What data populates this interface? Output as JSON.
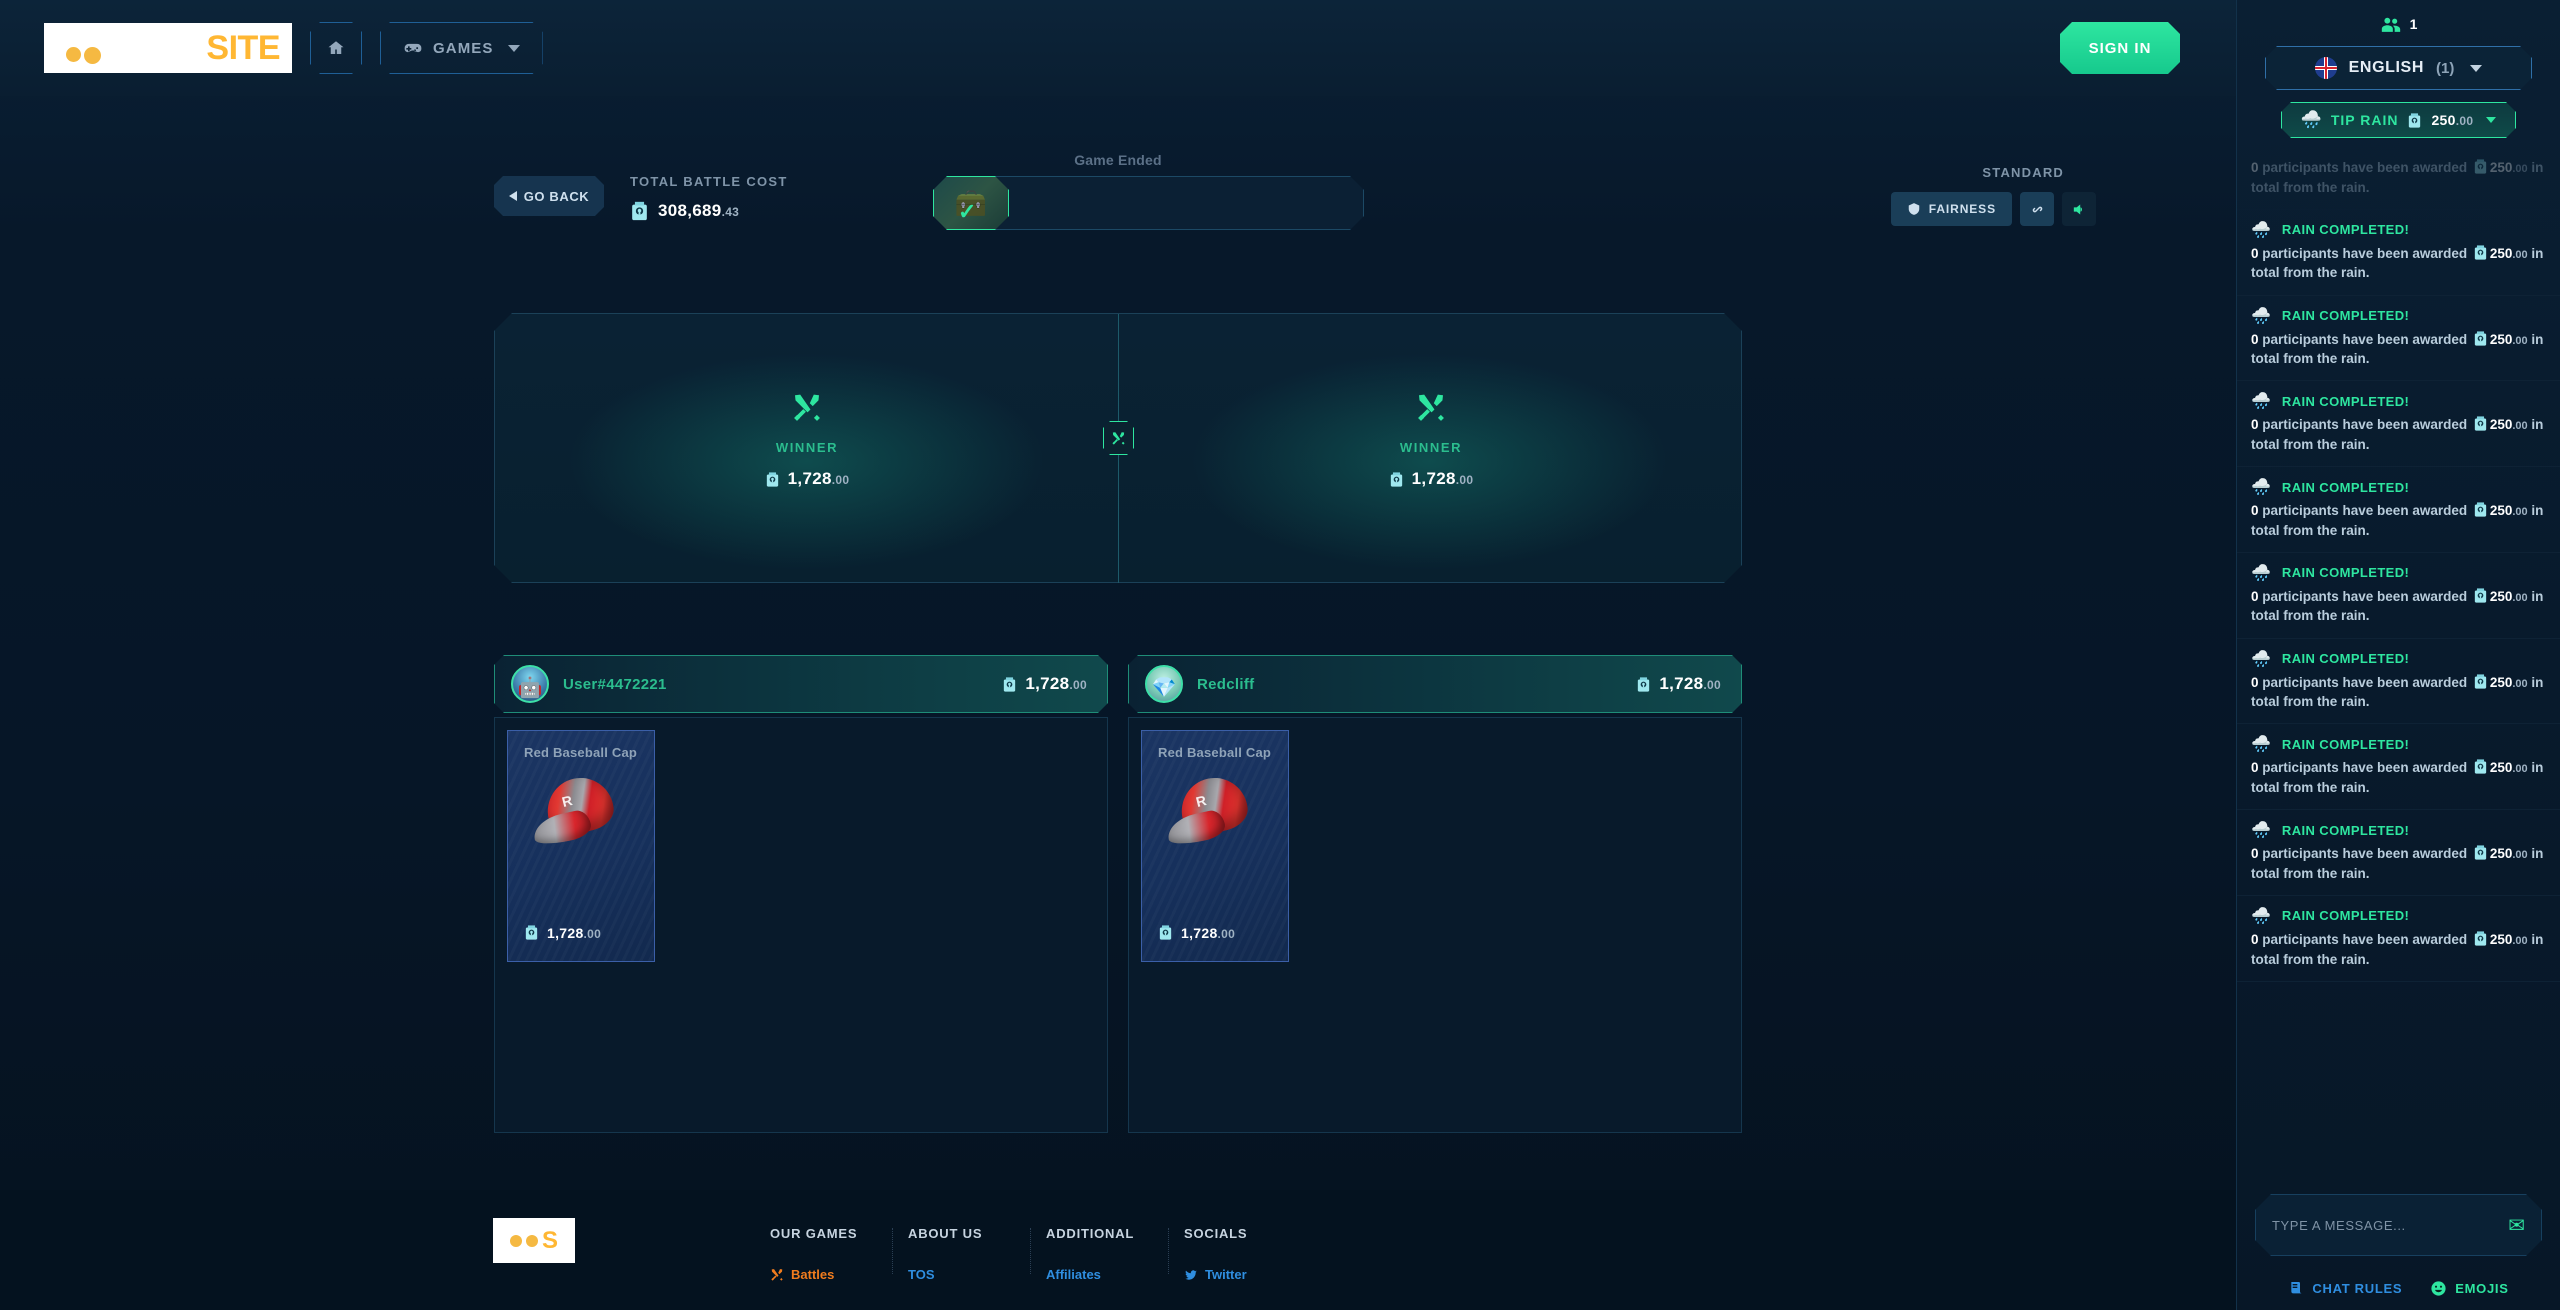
{
  "nav": {
    "logo_text": "SITE",
    "home_label": "Home",
    "games_label": "GAMES",
    "signin_label": "SIGN IN"
  },
  "battle": {
    "go_back": "GO BACK",
    "total_cost_label": "TOTAL BATTLE COST",
    "total_cost_value": "308,689",
    "total_cost_decimals": ".43",
    "status": "Game Ended",
    "mode": "STANDARD",
    "fairness_label": "FAIRNESS",
    "link_icon": "link-icon",
    "sound_icon": "sound-on-icon",
    "sides": [
      {
        "label": "WINNER",
        "value": "1,728",
        "decimals": ".00"
      },
      {
        "label": "WINNER",
        "value": "1,728",
        "decimals": ".00"
      }
    ]
  },
  "players": [
    {
      "name": "User#4472221",
      "total": "1,728",
      "total_decimals": ".00",
      "avatar_icon": "robot-avatar",
      "items": [
        {
          "name": "Red Baseball Cap",
          "price": "1,728",
          "price_decimals": ".00"
        }
      ]
    },
    {
      "name": "Redcliff",
      "total": "1,728",
      "total_decimals": ".00",
      "avatar_icon": "gem-avatar",
      "items": [
        {
          "name": "Red Baseball Cap",
          "price": "1,728",
          "price_decimals": ".00"
        }
      ]
    }
  ],
  "footer": {
    "logo_letter": "S",
    "tagline": "",
    "columns": [
      {
        "title": "OUR GAMES",
        "links": [
          {
            "label": "Battles",
            "style": "orange",
            "icon": "swords-icon"
          }
        ]
      },
      {
        "title": "ABOUT US",
        "links": [
          {
            "label": "TOS",
            "style": "blue",
            "icon": ""
          }
        ]
      },
      {
        "title": "ADDITIONAL",
        "links": [
          {
            "label": "Affiliates",
            "style": "blue",
            "icon": ""
          }
        ]
      },
      {
        "title": "SOCIALS",
        "links": [
          {
            "label": "Twitter",
            "style": "blue",
            "icon": "twitter-icon"
          }
        ]
      }
    ]
  },
  "chat": {
    "online_count": "1",
    "language": "ENGLISH",
    "language_count": "(1)",
    "tip_rain_label": "TIP RAIN",
    "tip_rain_amount": "250",
    "tip_rain_decimals": ".00",
    "input_placeholder": "TYPE A MESSAGE...",
    "chat_rules_label": "CHAT RULES",
    "emojis_label": "EMOJIS",
    "messages": [
      {
        "title": "",
        "faded": true,
        "prefix": "0",
        "text_a": " participants have been awarded ",
        "amount": "250",
        "decimals": ".00",
        "text_b": " in total from the rain."
      },
      {
        "title": "RAIN COMPLETED!",
        "faded": false,
        "prefix": "0",
        "text_a": " participants have been awarded ",
        "amount": "250",
        "decimals": ".00",
        "text_b": " in total from the rain."
      },
      {
        "title": "RAIN COMPLETED!",
        "faded": false,
        "prefix": "0",
        "text_a": " participants have been awarded ",
        "amount": "250",
        "decimals": ".00",
        "text_b": " in total from the rain."
      },
      {
        "title": "RAIN COMPLETED!",
        "faded": false,
        "prefix": "0",
        "text_a": " participants have been awarded ",
        "amount": "250",
        "decimals": ".00",
        "text_b": " in total from the rain."
      },
      {
        "title": "RAIN COMPLETED!",
        "faded": false,
        "prefix": "0",
        "text_a": " participants have been awarded ",
        "amount": "250",
        "decimals": ".00",
        "text_b": " in total from the rain."
      },
      {
        "title": "RAIN COMPLETED!",
        "faded": false,
        "prefix": "0",
        "text_a": " participants have been awarded ",
        "amount": "250",
        "decimals": ".00",
        "text_b": " in total from the rain."
      },
      {
        "title": "RAIN COMPLETED!",
        "faded": false,
        "prefix": "0",
        "text_a": " participants have been awarded ",
        "amount": "250",
        "decimals": ".00",
        "text_b": " in total from the rain."
      },
      {
        "title": "RAIN COMPLETED!",
        "faded": false,
        "prefix": "0",
        "text_a": " participants have been awarded ",
        "amount": "250",
        "decimals": ".00",
        "text_b": " in total from the rain."
      },
      {
        "title": "RAIN COMPLETED!",
        "faded": false,
        "prefix": "0",
        "text_a": " participants have been awarded ",
        "amount": "250",
        "decimals": ".00",
        "text_b": " in total from the rain."
      },
      {
        "title": "RAIN COMPLETED!",
        "faded": false,
        "prefix": "0",
        "text_a": " participants have been awarded ",
        "amount": "250",
        "decimals": ".00",
        "text_b": " in total from the rain."
      }
    ]
  },
  "colors": {
    "accent_green": "#2ee6a0",
    "accent_blue": "#2f8ee0",
    "accent_orange": "#ffb733",
    "bg_dark": "#061a2b"
  }
}
